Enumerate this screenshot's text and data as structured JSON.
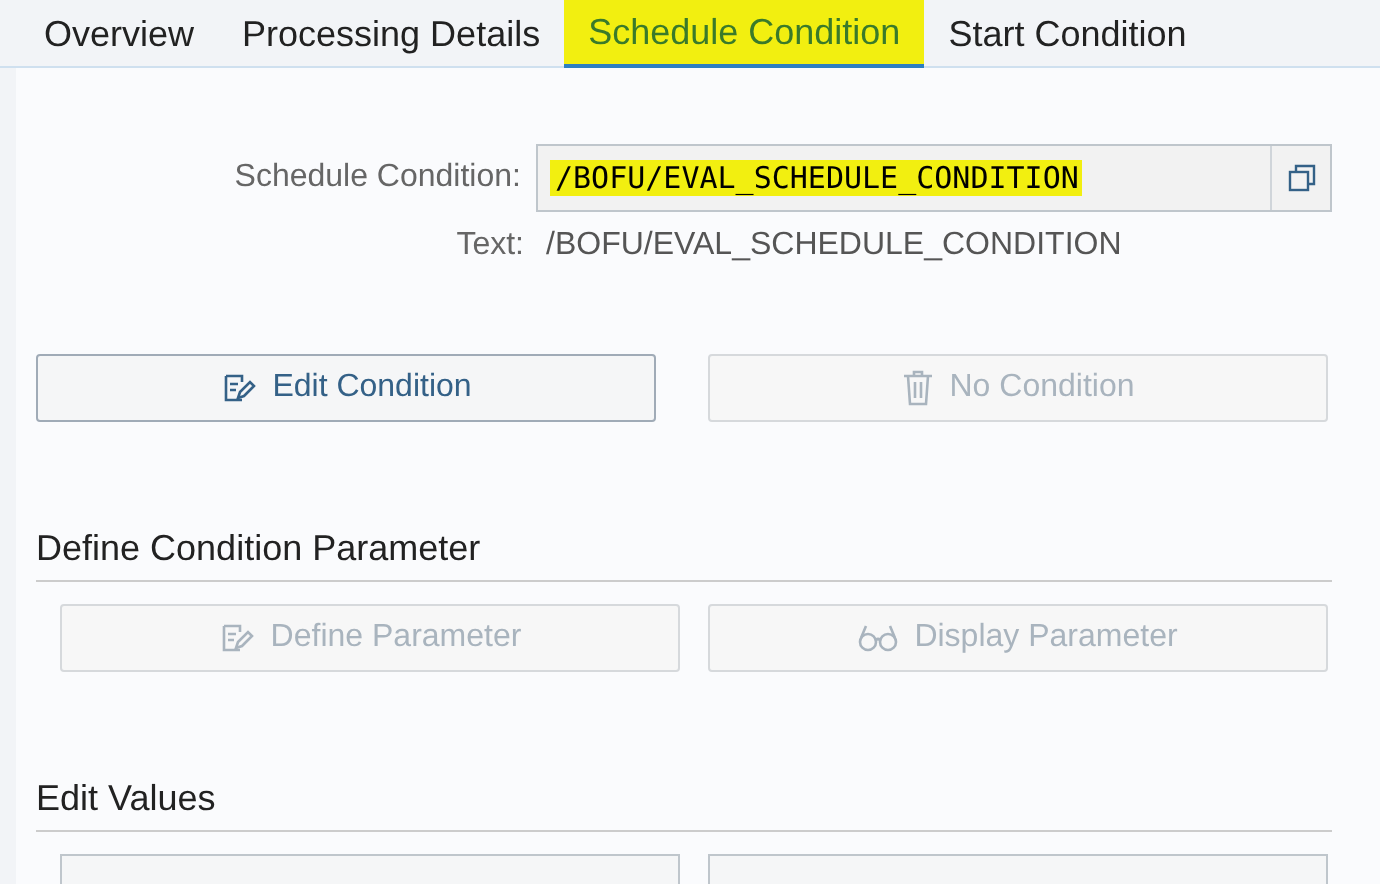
{
  "tabs": [
    {
      "label": "Overview",
      "selected": false,
      "highlighted": false
    },
    {
      "label": "Processing Details",
      "selected": false,
      "highlighted": false
    },
    {
      "label": "Schedule Condition",
      "selected": true,
      "highlighted": true
    },
    {
      "label": "Start Condition",
      "selected": false,
      "highlighted": false
    }
  ],
  "condition_field": {
    "label": "Schedule Condition:",
    "value": "/BOFU/EVAL_SCHEDULE_CONDITION",
    "highlighted": true
  },
  "text_row": {
    "label": "Text:",
    "value": "/BOFU/EVAL_SCHEDULE_CONDITION"
  },
  "main_buttons": [
    {
      "label": "Edit Condition",
      "kind": "edit",
      "disabled": false
    },
    {
      "label": "No Condition",
      "kind": "trash",
      "disabled": true
    }
  ],
  "sections": [
    {
      "title": "Define Condition Parameter",
      "buttons": [
        {
          "label": "Define Parameter",
          "kind": "edit",
          "disabled": true
        },
        {
          "label": "Display Parameter",
          "kind": "glasses",
          "disabled": true
        }
      ]
    },
    {
      "title": "Edit Values"
    }
  ]
}
